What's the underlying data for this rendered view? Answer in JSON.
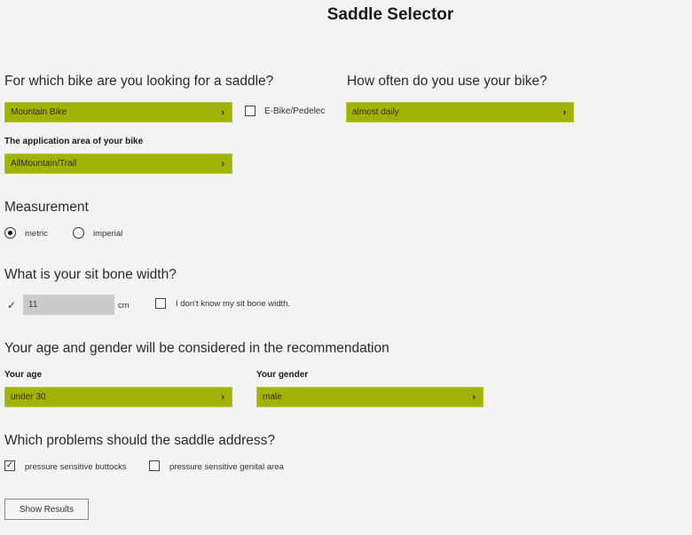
{
  "page": {
    "title": "Saddle Selector"
  },
  "bike": {
    "heading": "For which bike are you looking for a saddle?",
    "bike_type": "Mountain Bike",
    "ebike_label": "E-Bike/Pedelec",
    "ebike_checked": false,
    "application_label": "The application area of your bike",
    "application_value": "AllMountain/Trail",
    "chevron": "›"
  },
  "usage": {
    "heading": "How often do you use your bike?",
    "value": "almost daily"
  },
  "measurement": {
    "heading": "Measurement",
    "options": [
      {
        "label": "metric",
        "selected": true
      },
      {
        "label": "imperial",
        "selected": false
      }
    ]
  },
  "sitbone": {
    "heading": "What is your sit bone width?",
    "valid_mark": "✓",
    "value": "11",
    "unit": "cm",
    "unknown_label": "I don't know my sit bone width.",
    "unknown_checked": false
  },
  "demographics": {
    "heading": "Your age and gender will be considered in the recommendation",
    "age_label": "Your age",
    "age_value": "under 30",
    "gender_label": "Your gender",
    "gender_value": "male"
  },
  "problems": {
    "heading": "Which problems should the saddle address?",
    "options": [
      {
        "label": "pressure sensitive buttocks",
        "checked": true,
        "mark": "✓"
      },
      {
        "label": "pressure sensitive genital area",
        "checked": false,
        "mark": ""
      }
    ]
  },
  "actions": {
    "show_results": "Show Results"
  },
  "colors": {
    "accent": "#a2b307",
    "background": "#f3f3f3",
    "input_bg": "#cbcbcb"
  }
}
